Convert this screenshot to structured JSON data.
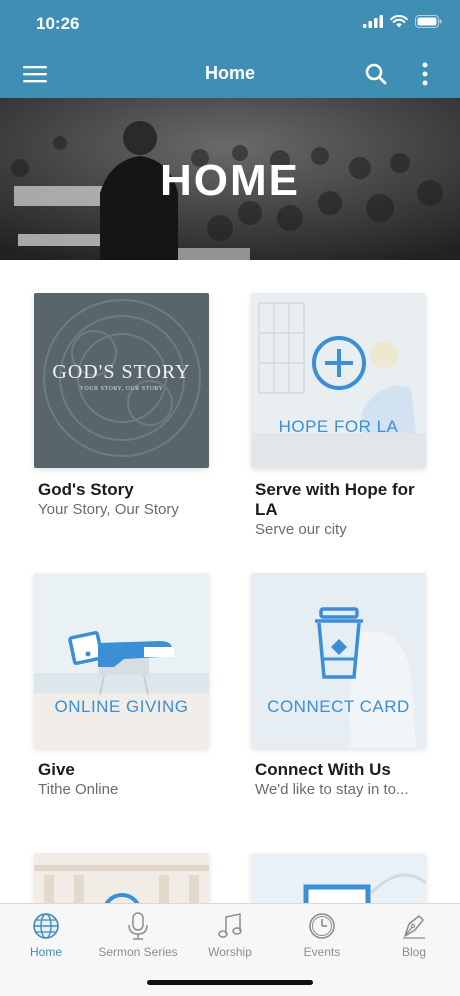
{
  "status": {
    "time": "10:26"
  },
  "nav": {
    "title": "Home"
  },
  "hero": {
    "title": "HOME"
  },
  "cards": [
    {
      "title": "God's Story",
      "subtitle": "Your Story, Our Story",
      "tile_title": "GOD'S STORY",
      "tile_subtitle": "YOUR STORY, OUR STORY"
    },
    {
      "title": "Serve with Hope for LA",
      "subtitle": "Serve our city",
      "tile_label": "HOPE FOR LA"
    },
    {
      "title": "Give",
      "subtitle": "Tithe Online",
      "tile_label": "ONLINE GIVING"
    },
    {
      "title": "Connect With Us",
      "subtitle": "We'd like to stay in to...",
      "tile_label": "CONNECT CARD"
    }
  ],
  "tabs": [
    {
      "label": "Home",
      "icon": "globe-icon",
      "active": true
    },
    {
      "label": "Sermon Series",
      "icon": "microphone-icon",
      "active": false
    },
    {
      "label": "Worship",
      "icon": "music-note-icon",
      "active": false
    },
    {
      "label": "Events",
      "icon": "clock-icon",
      "active": false
    },
    {
      "label": "Blog",
      "icon": "pen-icon",
      "active": false
    }
  ],
  "colors": {
    "brand": "#3f8eb3",
    "tile_accent": "#3a8fd6",
    "active_tab": "#3f8eb3",
    "inactive_tab": "#8d8d8d"
  }
}
